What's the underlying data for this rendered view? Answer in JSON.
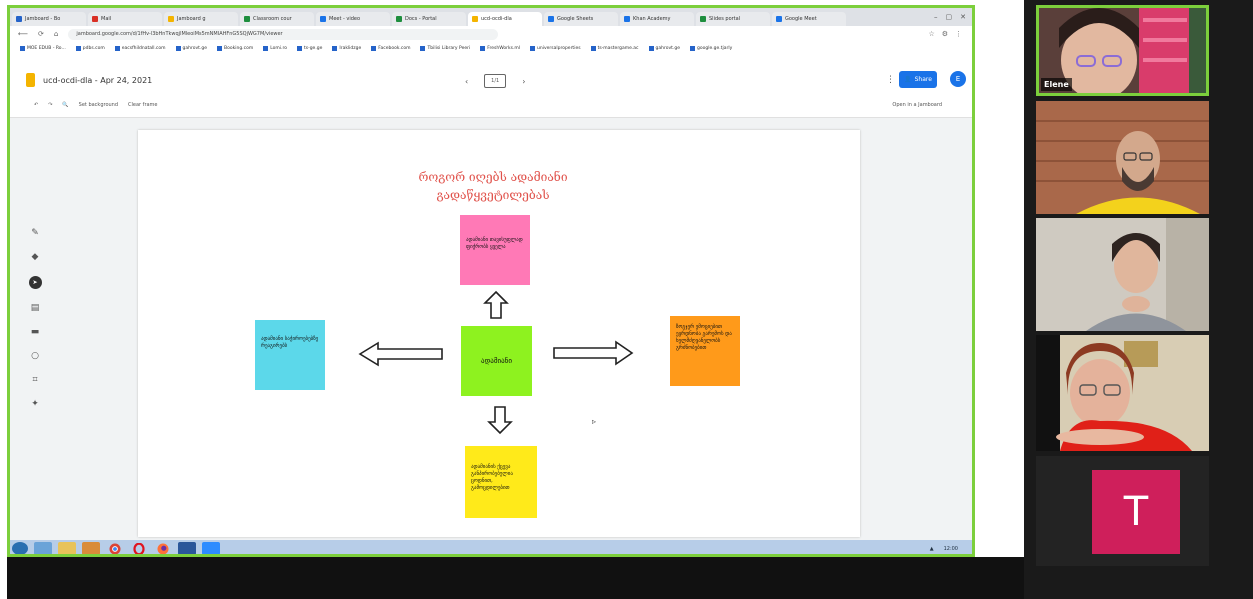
{
  "browser": {
    "tabs": [
      {
        "label": "Jamboard - Bo",
        "color": "#2563c9"
      },
      {
        "label": "Mail",
        "color": "#d93025"
      },
      {
        "label": "Jamboard g",
        "color": "#f4b400"
      },
      {
        "label": "Classroom cour",
        "color": "#1e8e3e"
      },
      {
        "label": "Meet - video",
        "color": "#1a73e8"
      },
      {
        "label": "Docs - Portal",
        "color": "#1e8e3e"
      },
      {
        "label": "ucd-ocdi-dla",
        "color": "#f4b400",
        "active": true
      },
      {
        "label": "Google Sheets",
        "color": "#1a73e8"
      },
      {
        "label": "Khan Academy",
        "color": "#1a73e8"
      },
      {
        "label": "Slides portal",
        "color": "#1e8e3e"
      },
      {
        "label": "Google Meet",
        "color": "#1a73e8"
      }
    ],
    "url": "jamboard.google.com/d/1fHv-l3bHnTkwqjlMleoiMs5mNMIAHFnG5SQjWG7M/viewer",
    "bookmarks": [
      "MOE EDUB - Ro...",
      "pdbs.com",
      "eacsfhildnatall.com",
      "gahrovt.ge",
      "Booking.com",
      "Lomi.ro",
      "ts-ge.ge",
      "Iraklidzge",
      "Facebook.com",
      "Tbilisi Library Peeri",
      "FreshWorks.ml",
      "universalproperties",
      "ts-mastergame.ac",
      "gahrovt.ge",
      "google.ge.tjarly"
    ]
  },
  "jamboard": {
    "title": "ucd-ocdi-dla - Apr 24, 2021",
    "frame_counter": "1/1",
    "share_label": "Share",
    "avatar_letter": "E",
    "toolbar_set_background": "Set background",
    "toolbar_clear_frame": "Clear frame",
    "toolbar_open_in_app": "Open in a Jamboard"
  },
  "board": {
    "title_line1": "როგორ იღებს ადამიანი",
    "title_line2": "გადაწყვეტილებას",
    "center_note": "ადამიანი",
    "top_note": "ადამიანი თავისუფლად ფიქრობს ყველა",
    "left_note": "ადამიანი საჭიროებებზე რეაგირებს",
    "right_note": "ზოგჯერ ემოციებით ეყრდნობა გარემოს და ხელმძღვანელობს გრძნობებით",
    "bottom_note": "ადამიანის ქცევა განპირობებულია ცოდნით, გამოცდილებით"
  },
  "colors": {
    "pink": "#ff79b6",
    "cyan": "#5cd8ea",
    "green": "#8ef21f",
    "orange": "#ff9a1a",
    "yellow": "#ffea1a",
    "share_border": "#7ccf3c",
    "t_avatar": "#cf1f5b"
  },
  "taskbar": {
    "clock": "12:00"
  },
  "participants": {
    "p1_name": "Elene",
    "p5_initial": "T"
  }
}
